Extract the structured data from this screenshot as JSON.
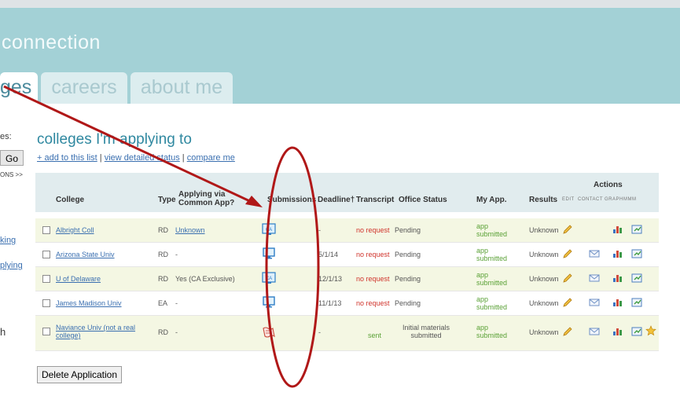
{
  "brand": {
    "text": "connection"
  },
  "tabs": [
    {
      "label": "ges"
    },
    {
      "label": "careers"
    },
    {
      "label": "about me"
    }
  ],
  "sidebar": {
    "fragment_1": "es:",
    "go_label": "Go",
    "fragment_2": "ONS >>",
    "fragment_3": "king",
    "fragment_4": "plying",
    "fragment_5": "h"
  },
  "main": {
    "heading": "colleges I'm applying to",
    "links": {
      "add": "+ add to this list",
      "sep1": " | ",
      "view": "view detailed status",
      "sep2": " | ",
      "compare": "compare me"
    }
  },
  "table": {
    "headers": {
      "college": "College",
      "type": "Type",
      "applying_via": "Applying via Common App?",
      "submissions": "Submissions",
      "deadline": "Deadline†",
      "transcript": "Transcript",
      "office_status": "Office Status",
      "my_app": "My App.",
      "results": "Results",
      "actions": "Actions",
      "edit": "EDIT",
      "contact": "CONTACT",
      "graph": "GRAPH",
      "mmm": "MMM"
    },
    "rows": [
      {
        "college": "Albright Coll",
        "type": "RD",
        "applying": "Unknown",
        "deadline": "-",
        "transcript": "no request",
        "office": "Pending",
        "myapp": "app submitted",
        "results": "Unknown"
      },
      {
        "college": "Arizona State Univ",
        "type": "RD",
        "applying": "-",
        "deadline": "5/1/14",
        "transcript": "no request",
        "office": "Pending",
        "myapp": "app submitted",
        "results": "Unknown"
      },
      {
        "college": "U of Delaware",
        "type": "RD",
        "applying": "Yes (CA Exclusive)",
        "deadline": "12/1/13",
        "transcript": "no request",
        "office": "Pending",
        "myapp": "app submitted",
        "results": "Unknown"
      },
      {
        "college": "James Madison Univ",
        "type": "EA",
        "applying": "-",
        "deadline": "11/1/13",
        "transcript": "no request",
        "office": "Pending",
        "myapp": "app submitted",
        "results": "Unknown"
      },
      {
        "college": "Naviance Univ (not a real college)",
        "type": "RD",
        "applying": "-",
        "deadline": "-",
        "transcript": "sent",
        "office": "Initial materials submitted",
        "myapp": "app submitted",
        "results": "Unknown"
      }
    ]
  },
  "delete_label": "Delete Application",
  "colors": {
    "banner": "#a3d1d6",
    "heading": "#2f88a0",
    "link": "#3a6fb0",
    "transcript_red": "#d0342c",
    "status_green": "#5aa136",
    "annotation_red": "#b01818"
  },
  "icons": {
    "submission": [
      "common-app-icon",
      "computer-icon",
      "common-app-icon",
      "computer-icon",
      "paper-icon"
    ],
    "actions": [
      "edit-pencil-icon",
      "contact-envelope-icon",
      "graph-bar-icon",
      "mmm-icon",
      "star-icon"
    ]
  }
}
